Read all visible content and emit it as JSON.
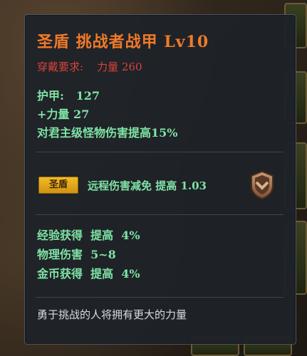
{
  "tooltip": {
    "title": "圣盾 挑战者战甲 Lv10",
    "requirement": "穿戴要求:    力量 260",
    "stats": [
      {
        "text": "护甲:   127"
      },
      {
        "text": "+力量 27"
      },
      {
        "text": "对君主级怪物伤害提高15%"
      }
    ],
    "set_badge": "圣盾",
    "set_bonus": "远程伤害减免 提高 1.03",
    "bonuses": [
      {
        "text": "经验获得  提高  4%"
      },
      {
        "text": "物理伤害  5~8"
      },
      {
        "text": "金币获得  提高  4%"
      }
    ],
    "flavor": "勇于挑战的人将拥有更大的力量",
    "colors": {
      "title": "#f07a2a",
      "requirement": "#d8433a",
      "stat": "#7fe3a6",
      "badge": "#e8aa1e",
      "flavor": "#d9dde2"
    },
    "icons": {
      "set_icon": "shield-chevron-icon"
    }
  }
}
